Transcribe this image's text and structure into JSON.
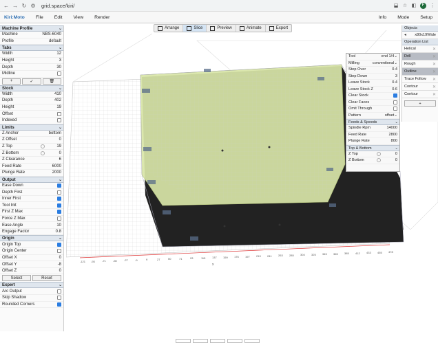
{
  "browser": {
    "url": "grid.space/kiri/",
    "avatar": "F"
  },
  "menubar": {
    "brand": "Kiri:Moto",
    "file": "File",
    "edit": "Edit",
    "view": "View",
    "render": "Render",
    "info": "Info",
    "mode": "Mode",
    "setup": "Setup"
  },
  "toolbar": {
    "arrange": "Arrange",
    "slice": "Slice",
    "preview": "Preview",
    "animate": "Animate",
    "export": "Export"
  },
  "left": {
    "machine_profile": {
      "header": "Machine Profile",
      "machine_label": "Machine",
      "machine_value": "NBS-6040",
      "profile_label": "Profile",
      "profile_value": "default"
    },
    "tabs": {
      "header": "Tabs",
      "width": "12",
      "height": "3",
      "depth": "30",
      "midline": "Midline"
    },
    "stock": {
      "header": "Stock",
      "width": "410",
      "depth": "402",
      "height": "19",
      "offset": "Offset",
      "indexed": "Indexed"
    },
    "limits": {
      "header": "Limits",
      "z_anchor": "bottom",
      "z_offset": "0",
      "z_top": "19",
      "z_bottom": "0",
      "z_clearance": "6",
      "feed_rate": "6000",
      "plunge_rate": "2000"
    },
    "output": {
      "header": "Output",
      "ease_down": "Ease Down",
      "depth_first": "Depth First",
      "inner_first": "Inner First",
      "tool_init": "Tool Init",
      "first_z_max": "First Z Max",
      "force_z_max": "Force Z Max",
      "ease_angle": "10",
      "engage_factor": "0.8"
    },
    "origin": {
      "header": "Origin",
      "origin_top": "Origin Top",
      "origin_center": "Origin Center",
      "offset_x": "0",
      "offset_y": "-8",
      "offset_z": "0",
      "select": "Select",
      "reset": "Reset"
    },
    "expert": {
      "header": "Expert",
      "arc_output": "Arc Output",
      "skip_shadow": "Skip Shadow",
      "rounded_corners": "Rounded Corners"
    }
  },
  "labels": {
    "width": "Width",
    "height": "Height",
    "depth": "Depth",
    "z_anchor": "Z Anchor",
    "z_offset": "Z Offset",
    "z_top": "Z Top",
    "z_bottom": "Z Bottom",
    "z_clearance": "Z Clearance",
    "feed_rate": "Feed Rate",
    "plunge_rate": "Plunge Rate",
    "ease_angle": "Ease Angle",
    "engage_factor": "Engage Factor",
    "offset_x": "Offset X",
    "offset_y": "Offset Y",
    "offset_z": "Offset Z"
  },
  "ops": {
    "tool_label": "Tool",
    "tool_value": "end 1/4",
    "milling_label": "Milling",
    "milling_value": "conventional",
    "step_over_label": "Step Over",
    "step_over": "0.4",
    "step_down_label": "Step Down",
    "step_down": "3",
    "leave_stock_label": "Leave Stock",
    "leave_stock": "0.4",
    "leave_stock_z_label": "Leave Stock Z",
    "leave_stock_z": "0.6",
    "clear_stock": "Clear Stock",
    "clear_faces": "Clear Faces",
    "omit_through": "Omit Through",
    "pattern_label": "Pattern",
    "pattern_value": "offset",
    "feeds_header": "Feeds & Speeds",
    "spindle_label": "Spindle Rpm",
    "spindle": "14000",
    "feed_label": "Feed Rate",
    "feed": "2800",
    "plunge_label": "Plunge Rate",
    "plunge": "800",
    "topbottom_header": "Top & Bottom",
    "ztop_label": "Z Top",
    "ztop": "0",
    "zbottom_label": "Z Bottom",
    "zbottom": "0"
  },
  "objects": {
    "header": "Objects",
    "object_name": "x80x19Wide",
    "oplist_header": "Operation List",
    "items": [
      "Helical",
      "Drill",
      "Rough",
      "Outline",
      "Trace Follow",
      "Contour",
      "Contour"
    ],
    "add": "+"
  },
  "axis": {
    "x_ticks": [
      "-121",
      "-93",
      "-71",
      "-50",
      "-27",
      "-9",
      "9",
      "27",
      "50",
      "71",
      "93",
      "115",
      "137",
      "159",
      "176",
      "197",
      "219",
      "241",
      "263",
      "285",
      "304",
      "325",
      "345",
      "365",
      "385",
      "412",
      "433",
      "455",
      "478"
    ],
    "x_label": "x"
  },
  "colors": {
    "accent": "#2b7de1",
    "brand": "#2d6fb3",
    "part": "#d9e6a8"
  }
}
